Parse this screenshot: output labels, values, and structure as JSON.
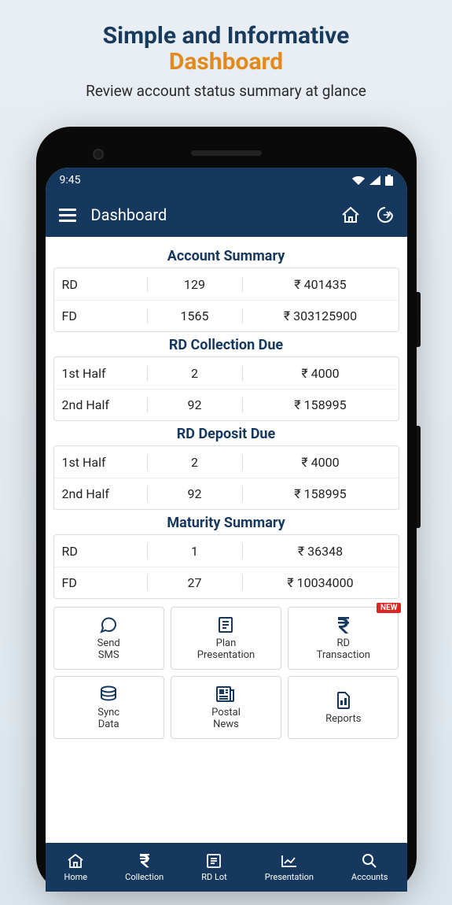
{
  "promo": {
    "title_line1": "Simple and Informative",
    "title_line2": "Dashboard",
    "subtitle": "Review account status summary at glance"
  },
  "status": {
    "time": "9:45"
  },
  "appbar": {
    "title": "Dashboard"
  },
  "sections": {
    "account_summary": {
      "title": "Account Summary",
      "rows": [
        {
          "label": "RD",
          "count": "129",
          "amount": "₹ 401435"
        },
        {
          "label": "FD",
          "count": "1565",
          "amount": "₹ 303125900"
        }
      ]
    },
    "rd_collection_due": {
      "title": "RD Collection Due",
      "rows": [
        {
          "label": "1st Half",
          "count": "2",
          "amount": "₹ 4000"
        },
        {
          "label": "2nd Half",
          "count": "92",
          "amount": "₹ 158995"
        }
      ]
    },
    "rd_deposit_due": {
      "title": "RD Deposit Due",
      "rows": [
        {
          "label": "1st Half",
          "count": "2",
          "amount": "₹ 4000"
        },
        {
          "label": "2nd Half",
          "count": "92",
          "amount": "₹ 158995"
        }
      ]
    },
    "maturity_summary": {
      "title": "Maturity Summary",
      "rows": [
        {
          "label": "RD",
          "count": "1",
          "amount": "₹ 36348"
        },
        {
          "label": "FD",
          "count": "27",
          "amount": "₹ 10034000"
        }
      ]
    }
  },
  "actions": [
    {
      "id": "send-sms",
      "label": "Send\nSMS",
      "icon": "chat-icon",
      "badge": ""
    },
    {
      "id": "plan-presentation",
      "label": "Plan\nPresentation",
      "icon": "list-icon",
      "badge": ""
    },
    {
      "id": "rd-transaction",
      "label": "RD\nTransaction",
      "icon": "rupee-icon",
      "badge": "NEW"
    },
    {
      "id": "sync-data",
      "label": "Sync\nData",
      "icon": "sync-icon",
      "badge": ""
    },
    {
      "id": "postal-news",
      "label": "Postal\nNews",
      "icon": "news-icon",
      "badge": ""
    },
    {
      "id": "reports",
      "label": "Reports",
      "icon": "report-icon",
      "badge": ""
    }
  ],
  "nav": [
    {
      "id": "home",
      "label": "Home",
      "icon": "home-icon"
    },
    {
      "id": "collection",
      "label": "Collection",
      "icon": "rupee-icon"
    },
    {
      "id": "rd-lot",
      "label": "RD Lot",
      "icon": "list-icon"
    },
    {
      "id": "presentation",
      "label": "Presentation",
      "icon": "chart-icon"
    },
    {
      "id": "accounts",
      "label": "Accounts",
      "icon": "search-icon"
    }
  ]
}
